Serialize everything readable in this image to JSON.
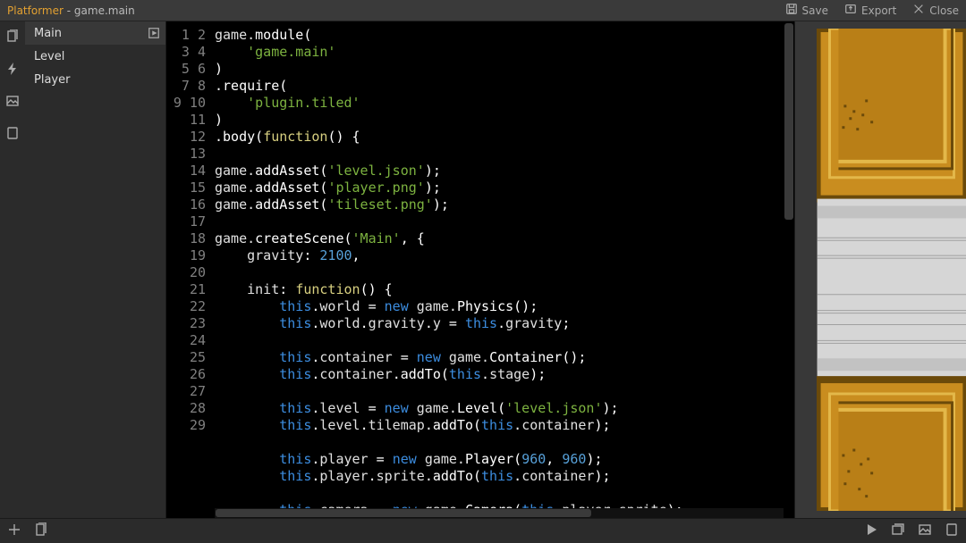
{
  "title": {
    "project": "Platformer",
    "separator": " - ",
    "module": "game.main"
  },
  "toolbar": {
    "save": "Save",
    "export": "Export",
    "close": "Close"
  },
  "sidebar": {
    "items": [
      {
        "label": "Main",
        "selected": true,
        "runnable": true
      },
      {
        "label": "Level",
        "selected": false,
        "runnable": false
      },
      {
        "label": "Player",
        "selected": false,
        "runnable": false
      }
    ]
  },
  "rail_icons": [
    "docs-icon",
    "bolt-icon",
    "image-icon",
    "rect-icon"
  ],
  "bottom_icons_left": [
    "plus-icon",
    "doc-icon"
  ],
  "bottom_icons_right": [
    "play-icon",
    "gallery-icon",
    "image-icon",
    "rect-icon"
  ],
  "lines": [
    1,
    2,
    3,
    4,
    5,
    6,
    7,
    8,
    9,
    10,
    11,
    12,
    13,
    14,
    15,
    16,
    17,
    18,
    19,
    20,
    21,
    22,
    23,
    24,
    25,
    26,
    27,
    28,
    29
  ],
  "code": [
    [
      [
        "id",
        "game."
      ],
      [
        "call",
        "module"
      ],
      [
        "op",
        "("
      ]
    ],
    [
      [
        "op",
        "    "
      ],
      [
        "str",
        "'game.main'"
      ]
    ],
    [
      [
        "op",
        ")"
      ]
    ],
    [
      [
        "op",
        "."
      ],
      [
        "call",
        "require"
      ],
      [
        "op",
        "("
      ]
    ],
    [
      [
        "op",
        "    "
      ],
      [
        "str",
        "'plugin.tiled'"
      ]
    ],
    [
      [
        "op",
        ")"
      ]
    ],
    [
      [
        "op",
        "."
      ],
      [
        "call",
        "body"
      ],
      [
        "op",
        "("
      ],
      [
        "fn",
        "function"
      ],
      [
        "op",
        "() {"
      ]
    ],
    [],
    [
      [
        "id",
        "game."
      ],
      [
        "call",
        "addAsset"
      ],
      [
        "op",
        "("
      ],
      [
        "str",
        "'level.json'"
      ],
      [
        "op",
        ");"
      ]
    ],
    [
      [
        "id",
        "game."
      ],
      [
        "call",
        "addAsset"
      ],
      [
        "op",
        "("
      ],
      [
        "str",
        "'player.png'"
      ],
      [
        "op",
        ");"
      ]
    ],
    [
      [
        "id",
        "game."
      ],
      [
        "call",
        "addAsset"
      ],
      [
        "op",
        "("
      ],
      [
        "str",
        "'tileset.png'"
      ],
      [
        "op",
        ");"
      ]
    ],
    [],
    [
      [
        "id",
        "game."
      ],
      [
        "call",
        "createScene"
      ],
      [
        "op",
        "("
      ],
      [
        "str",
        "'Main'"
      ],
      [
        "op",
        ", {"
      ]
    ],
    [
      [
        "op",
        "    "
      ],
      [
        "id",
        "gravity"
      ],
      [
        "op",
        ": "
      ],
      [
        "num",
        "2100"
      ],
      [
        "op",
        ","
      ]
    ],
    [],
    [
      [
        "op",
        "    "
      ],
      [
        "id",
        "init"
      ],
      [
        "op",
        ": "
      ],
      [
        "fn",
        "function"
      ],
      [
        "op",
        "() {"
      ]
    ],
    [
      [
        "op",
        "        "
      ],
      [
        "kw",
        "this"
      ],
      [
        "op",
        "."
      ],
      [
        "id",
        "world"
      ],
      [
        "op",
        " = "
      ],
      [
        "kw",
        "new"
      ],
      [
        "op",
        " "
      ],
      [
        "id",
        "game."
      ],
      [
        "call",
        "Physics"
      ],
      [
        "op",
        "();"
      ]
    ],
    [
      [
        "op",
        "        "
      ],
      [
        "kw",
        "this"
      ],
      [
        "op",
        "."
      ],
      [
        "id",
        "world"
      ],
      [
        "op",
        "."
      ],
      [
        "id",
        "gravity"
      ],
      [
        "op",
        "."
      ],
      [
        "id",
        "y"
      ],
      [
        "op",
        " = "
      ],
      [
        "kw",
        "this"
      ],
      [
        "op",
        "."
      ],
      [
        "id",
        "gravity"
      ],
      [
        "op",
        ";"
      ]
    ],
    [],
    [
      [
        "op",
        "        "
      ],
      [
        "kw",
        "this"
      ],
      [
        "op",
        "."
      ],
      [
        "id",
        "container"
      ],
      [
        "op",
        " = "
      ],
      [
        "kw",
        "new"
      ],
      [
        "op",
        " "
      ],
      [
        "id",
        "game."
      ],
      [
        "call",
        "Container"
      ],
      [
        "op",
        "();"
      ]
    ],
    [
      [
        "op",
        "        "
      ],
      [
        "kw",
        "this"
      ],
      [
        "op",
        "."
      ],
      [
        "id",
        "container"
      ],
      [
        "op",
        "."
      ],
      [
        "call",
        "addTo"
      ],
      [
        "op",
        "("
      ],
      [
        "kw",
        "this"
      ],
      [
        "op",
        "."
      ],
      [
        "id",
        "stage"
      ],
      [
        "op",
        ");"
      ]
    ],
    [],
    [
      [
        "op",
        "        "
      ],
      [
        "kw",
        "this"
      ],
      [
        "op",
        "."
      ],
      [
        "id",
        "level"
      ],
      [
        "op",
        " = "
      ],
      [
        "kw",
        "new"
      ],
      [
        "op",
        " "
      ],
      [
        "id",
        "game."
      ],
      [
        "call",
        "Level"
      ],
      [
        "op",
        "("
      ],
      [
        "str",
        "'level.json'"
      ],
      [
        "op",
        ");"
      ]
    ],
    [
      [
        "op",
        "        "
      ],
      [
        "kw",
        "this"
      ],
      [
        "op",
        "."
      ],
      [
        "id",
        "level"
      ],
      [
        "op",
        "."
      ],
      [
        "id",
        "tilemap"
      ],
      [
        "op",
        "."
      ],
      [
        "call",
        "addTo"
      ],
      [
        "op",
        "("
      ],
      [
        "kw",
        "this"
      ],
      [
        "op",
        "."
      ],
      [
        "id",
        "container"
      ],
      [
        "op",
        ");"
      ]
    ],
    [],
    [
      [
        "op",
        "        "
      ],
      [
        "kw",
        "this"
      ],
      [
        "op",
        "."
      ],
      [
        "id",
        "player"
      ],
      [
        "op",
        " = "
      ],
      [
        "kw",
        "new"
      ],
      [
        "op",
        " "
      ],
      [
        "id",
        "game."
      ],
      [
        "call",
        "Player"
      ],
      [
        "op",
        "("
      ],
      [
        "num",
        "960"
      ],
      [
        "op",
        ", "
      ],
      [
        "num",
        "960"
      ],
      [
        "op",
        ");"
      ]
    ],
    [
      [
        "op",
        "        "
      ],
      [
        "kw",
        "this"
      ],
      [
        "op",
        "."
      ],
      [
        "id",
        "player"
      ],
      [
        "op",
        "."
      ],
      [
        "id",
        "sprite"
      ],
      [
        "op",
        "."
      ],
      [
        "call",
        "addTo"
      ],
      [
        "op",
        "("
      ],
      [
        "kw",
        "this"
      ],
      [
        "op",
        "."
      ],
      [
        "id",
        "container"
      ],
      [
        "op",
        ");"
      ]
    ],
    [],
    [
      [
        "op",
        "        "
      ],
      [
        "kw",
        "this"
      ],
      [
        "op",
        "."
      ],
      [
        "id",
        "camera"
      ],
      [
        "op",
        " = "
      ],
      [
        "kw",
        "new"
      ],
      [
        "op",
        " "
      ],
      [
        "id",
        "game."
      ],
      [
        "call",
        "Camera"
      ],
      [
        "op",
        "("
      ],
      [
        "kw",
        "this"
      ],
      [
        "op",
        "."
      ],
      [
        "id",
        "player"
      ],
      [
        "op",
        "."
      ],
      [
        "id",
        "sprite"
      ],
      [
        "op",
        ");"
      ]
    ]
  ]
}
